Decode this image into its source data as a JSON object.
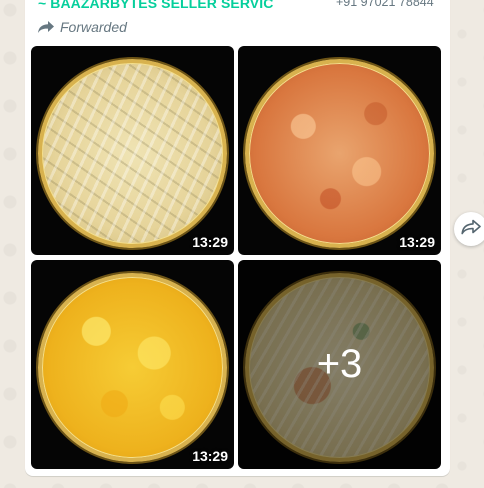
{
  "message": {
    "sender_name": "~ BAAZARBYTES SELLER SERVIC",
    "sender_phone": "+91 97021 78844",
    "forwarded_label": "Forwarded",
    "album": {
      "images": [
        {
          "name": "fries",
          "time": "13:29"
        },
        {
          "name": "masala-chips",
          "time": "13:29"
        },
        {
          "name": "banana-chips",
          "time": "13:29"
        },
        {
          "name": "more-overlay",
          "more_count": "+3"
        }
      ]
    }
  },
  "icons": {
    "forwarded": "forward-arrow-icon",
    "share": "forward-share-icon"
  },
  "colors": {
    "sender": "#06cf9c",
    "bubble": "#ffffff",
    "wallpaper": "#efeae2",
    "plate_rim": "#d8b24e",
    "meta_text": "#667781"
  }
}
